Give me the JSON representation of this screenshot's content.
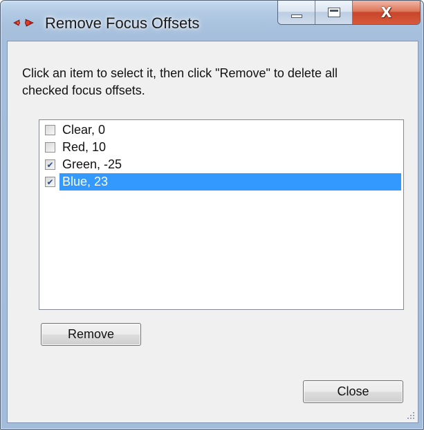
{
  "window": {
    "title": "Remove Focus Offsets",
    "icon": "app-icon",
    "caption_buttons": {
      "minimize": "minimize-icon",
      "maximize": "maximize-icon",
      "close": "close-icon",
      "close_glyph": "X"
    }
  },
  "dialog": {
    "instructions": "Click an item to select it, then click \"Remove\" to delete all checked focus offsets.",
    "items": [
      {
        "label": "Clear, 0",
        "checked": false,
        "selected": false
      },
      {
        "label": "Red, 10",
        "checked": false,
        "selected": false
      },
      {
        "label": "Green, -25",
        "checked": true,
        "selected": false
      },
      {
        "label": "Blue, 23",
        "checked": true,
        "selected": true
      }
    ],
    "remove_label": "Remove",
    "close_label": "Close"
  },
  "colors": {
    "selection": "#3399ff",
    "close_button": "#c8452b",
    "frame": "#a9c2de"
  }
}
